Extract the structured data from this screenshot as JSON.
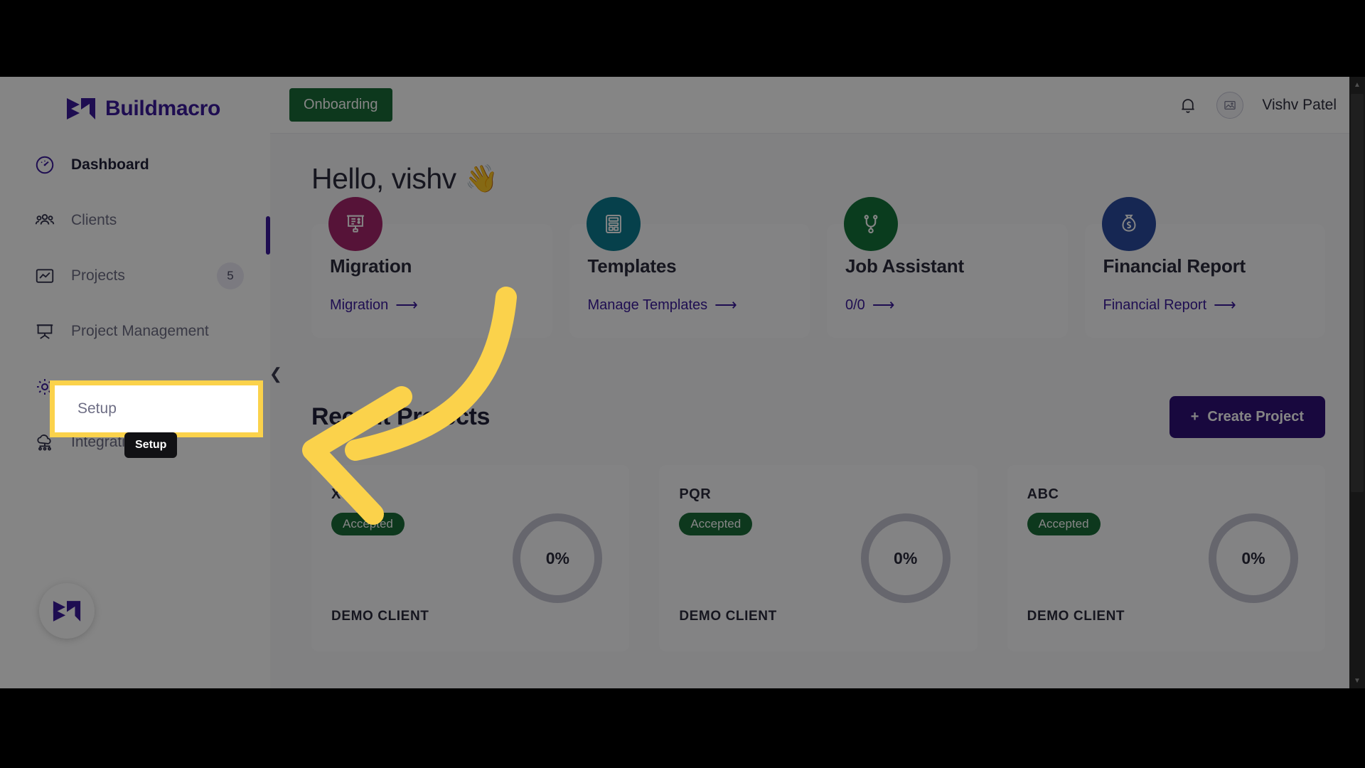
{
  "brand": {
    "name": "Buildmacro",
    "logo_icon": "buildmacro-m-logo"
  },
  "sidebar": {
    "items": [
      {
        "label": "Dashboard",
        "icon": "speedometer-icon",
        "active": true,
        "badge": ""
      },
      {
        "label": "Clients",
        "icon": "people-group-icon",
        "active": false,
        "badge": ""
      },
      {
        "label": "Projects",
        "icon": "chart-box-icon",
        "active": false,
        "badge": "5"
      },
      {
        "label": "Project Management",
        "icon": "presentation-board-icon",
        "active": false,
        "badge": ""
      },
      {
        "label": "Setup",
        "icon": "gear-icon",
        "active": false,
        "badge": ""
      },
      {
        "label": "Integrations",
        "icon": "cloud-network-icon",
        "active": false,
        "badge": ""
      }
    ],
    "collapse_icon": "chevron-left-icon",
    "bottom_logo_icon": "buildmacro-m-logo"
  },
  "topbar": {
    "onboarding_tab": "Onboarding",
    "bell_icon": "bell-icon",
    "avatar_icon": "image-placeholder-icon",
    "user_name": "Vishv Patel"
  },
  "main": {
    "greeting": "Hello, vishv",
    "wave_emoji": "👋",
    "tiles": [
      {
        "title": "Migration",
        "link": "Migration",
        "icon": "presentation-chart-icon",
        "color": "#A6266B"
      },
      {
        "title": "Templates",
        "link": "Manage Templates",
        "icon": "calculator-icon",
        "color": "#0C7C91"
      },
      {
        "title": "Job Assistant",
        "link": "0/0",
        "icon": "stethoscope-icon",
        "color": "#15743A"
      },
      {
        "title": "Financial Report",
        "link": "Financial Report",
        "icon": "money-bag-icon",
        "color": "#2B4CA0"
      }
    ],
    "recent_projects_title": "Recent Projects",
    "create_button": "Create Project",
    "create_button_icon": "plus-icon",
    "projects": [
      {
        "name": "XYZ",
        "status": "Accepted",
        "client": "DEMO CLIENT",
        "progress": "0%"
      },
      {
        "name": "PQR",
        "status": "Accepted",
        "client": "DEMO CLIENT",
        "progress": "0%"
      },
      {
        "name": "ABC",
        "status": "Accepted",
        "client": "DEMO CLIENT",
        "progress": "0%"
      }
    ]
  },
  "annotation": {
    "highlight_label": "Setup",
    "tooltip_label": "Setup",
    "highlight_color": "#FBD24B",
    "arrow_icon": "curved-left-arrow"
  },
  "colors": {
    "brand_purple": "#3b1a9c",
    "green": "#1a6b38",
    "highlight_yellow": "#FBD24B",
    "create_button": "#2f1178"
  }
}
